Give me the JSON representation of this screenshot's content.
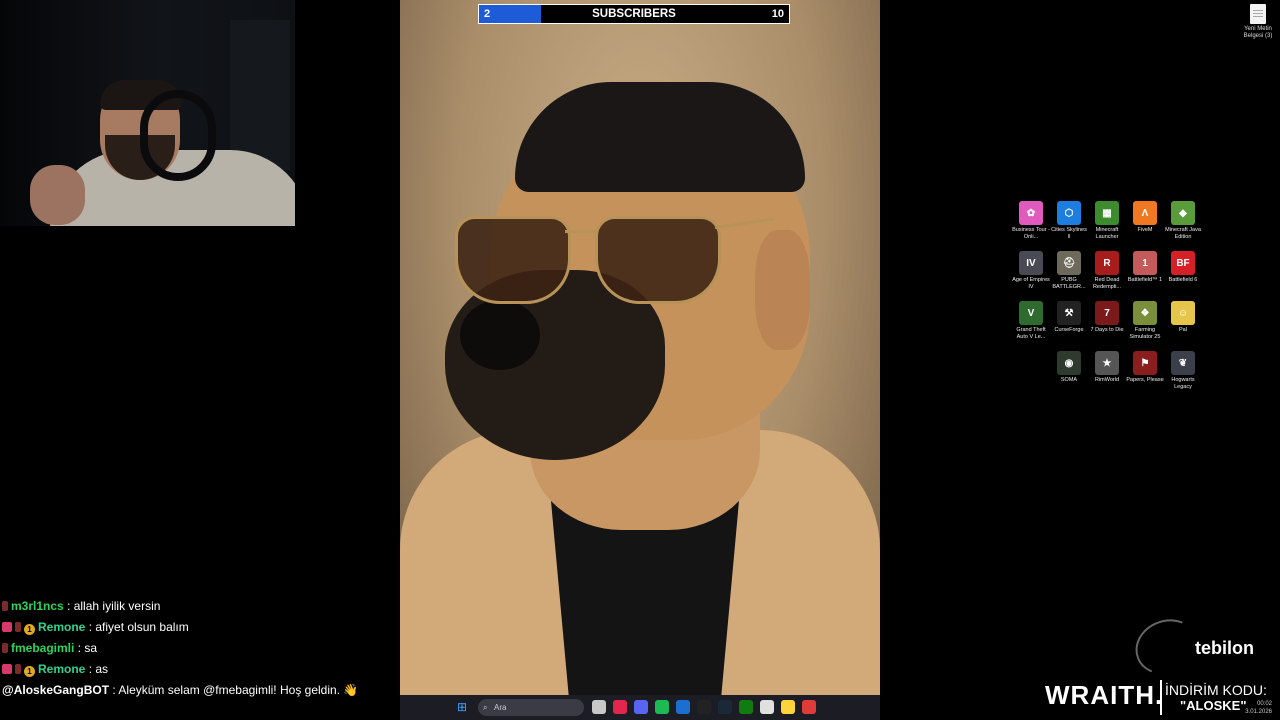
{
  "subscribers": {
    "current": "2",
    "label": "SUBSCRIBERS",
    "goal": "10",
    "progress_fraction": 0.2,
    "fill_color": "#1e5bd6"
  },
  "desktop_file": {
    "label": "Yeni Metin Belgesi (3)"
  },
  "desktop_icons": [
    {
      "label": "Business Tour - Onli...",
      "color": "#e05bbd",
      "glyph": "✿"
    },
    {
      "label": "Cities Skylines II",
      "color": "#1d7ee0",
      "glyph": "⬡"
    },
    {
      "label": "Minecraft Launcher",
      "color": "#3c8b2d",
      "glyph": "▦"
    },
    {
      "label": "FiveM",
      "color": "#f07822",
      "glyph": "Λ"
    },
    {
      "label": "Minecraft Java Edition",
      "color": "#5a9b3a",
      "glyph": "◆"
    },
    {
      "label": "Age of Empires IV",
      "color": "#4a4a55",
      "glyph": "IV"
    },
    {
      "label": "PUBG BATTLEGR...",
      "color": "#6d6a5c",
      "glyph": "⛑"
    },
    {
      "label": "Red Dead Redempti...",
      "color": "#a81c1c",
      "glyph": "R"
    },
    {
      "label": "Battlefield™ 1",
      "color": "#c45a5a",
      "glyph": "1"
    },
    {
      "label": "Battlefield 6",
      "color": "#d61f26",
      "glyph": "BF"
    },
    {
      "label": "Grand Theft Auto V Le...",
      "color": "#2f6b2f",
      "glyph": "V"
    },
    {
      "label": "CurseForge",
      "color": "#222222",
      "glyph": "⚒"
    },
    {
      "label": "7 Days to Die",
      "color": "#7a1a1a",
      "glyph": "7"
    },
    {
      "label": "Farming Simulator 25",
      "color": "#7b8f3a",
      "glyph": "❖"
    },
    {
      "label": "Pal",
      "color": "#e6c64a",
      "glyph": "☺"
    },
    {
      "label": "",
      "color": "#000000",
      "glyph": ""
    },
    {
      "label": "SOMA",
      "color": "#2f3a2f",
      "glyph": "◉"
    },
    {
      "label": "RimWorld",
      "color": "#555555",
      "glyph": "★"
    },
    {
      "label": "Papers, Please",
      "color": "#8a1e1e",
      "glyph": "⚑"
    },
    {
      "label": "Hogwarts Legacy",
      "color": "#3b3f4a",
      "glyph": "❦"
    }
  ],
  "chat": [
    {
      "badges": [
        "sub"
      ],
      "user": "m3rl1ncs",
      "user_color": "#2fd35a",
      "message": ": allah iyilik versin"
    },
    {
      "badges": [
        "gift",
        "sub",
        "coin"
      ],
      "user": "Remone",
      "user_color": "#2fd38e",
      "message": ": afiyet olsun balım"
    },
    {
      "badges": [
        "sub"
      ],
      "user": "fmebagimli",
      "user_color": "#2fd35a",
      "message": ": sa"
    },
    {
      "badges": [
        "gift",
        "sub",
        "coin"
      ],
      "user": "Remone",
      "user_color": "#2fd38e",
      "message": ": as"
    },
    {
      "badges": [],
      "user": "@AloskeGangBOT",
      "user_color": "#ffffff",
      "message": ": Aleyküm selam @fmebagimli! Hoş geldin. 👋"
    }
  ],
  "coin_glyph": "1",
  "taskbar": {
    "search_placeholder": "Ara",
    "apps": [
      "#c8c8c8",
      "#e2264d",
      "#5865f2",
      "#1db954",
      "#1b6fd1",
      "#222222",
      "#1b2838",
      "#107c10",
      "#e0e0e0",
      "#ffd43b",
      "#e03b3b"
    ]
  },
  "sponsor": {
    "brand": "tebilon",
    "product": "WRAITH.",
    "code_label": "İNDİRİM KODU:",
    "code": "\"ALOSKE\""
  },
  "tray": {
    "time": "00:02",
    "date": "3.01.2026"
  }
}
